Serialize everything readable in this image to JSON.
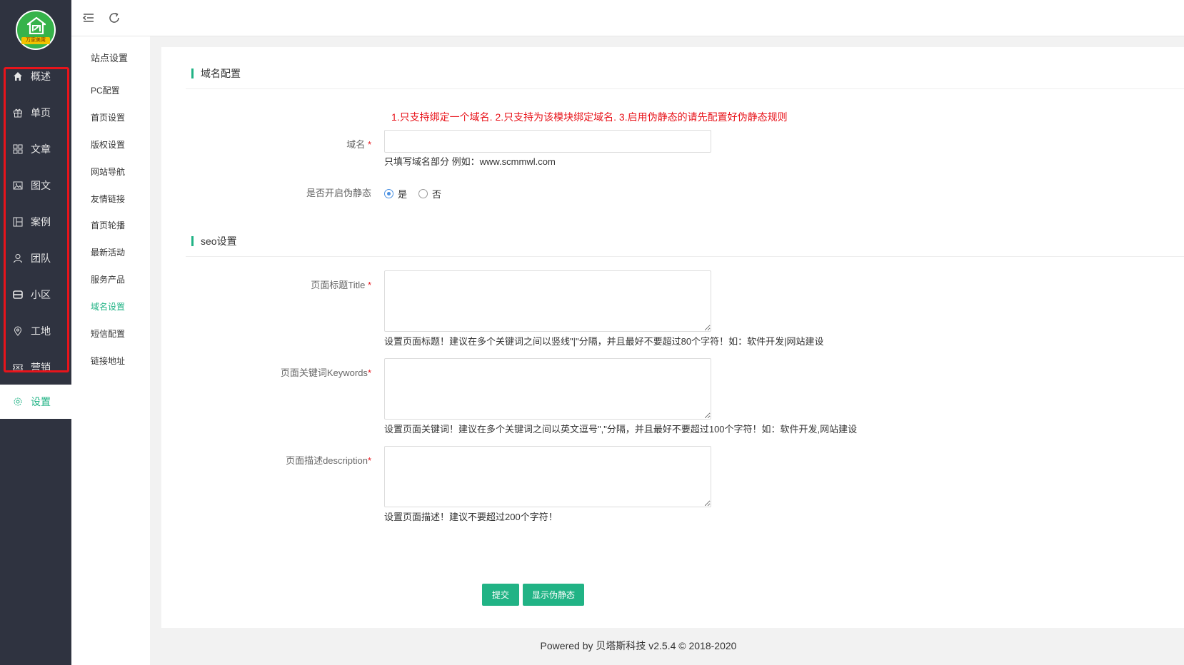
{
  "brand": {
    "logo_text": "万家美寓"
  },
  "sidebar": {
    "items": [
      {
        "label": "概述",
        "icon": "home-icon"
      },
      {
        "label": "单页",
        "icon": "gift-icon"
      },
      {
        "label": "文章",
        "icon": "grid-icon"
      },
      {
        "label": "图文",
        "icon": "image-icon"
      },
      {
        "label": "案例",
        "icon": "layout-icon"
      },
      {
        "label": "团队",
        "icon": "user-icon"
      },
      {
        "label": "小区",
        "icon": "inbox-icon"
      },
      {
        "label": "工地",
        "icon": "location-icon"
      },
      {
        "label": "营销",
        "icon": "ticket-icon"
      },
      {
        "label": "设置",
        "icon": "gear-icon",
        "active": true
      }
    ],
    "highlight_color": "#e8141b"
  },
  "topbar": {
    "menu_icon": "menu-fold-icon",
    "refresh_icon": "refresh-icon"
  },
  "subnav": {
    "title": "站点设置",
    "items": [
      "PC配置",
      "首页设置",
      "版权设置",
      "网站导航",
      "友情链接",
      "首页轮播",
      "最新活动",
      "服务产品",
      "域名设置",
      "短信配置",
      "链接地址"
    ],
    "active_index": 8
  },
  "form": {
    "section_domain": "域名配置",
    "notice": "1.只支持绑定一个域名. 2.只支持为该模块绑定域名. 3.启用伪静态的请先配置好伪静态规则",
    "domain_label": "域名",
    "domain_value": "",
    "domain_hint": "只填写域名部分 例如：www.scmmwl.com",
    "pseudo_label": "是否开启伪静态",
    "pseudo_yes": "是",
    "pseudo_no": "否",
    "pseudo_selected": "是",
    "section_seo": "seo设置",
    "title_label": "页面标题Title",
    "title_value": "",
    "title_hint": "设置页面标题！建议在多个关键词之间以竖线\"|\"分隔，并且最好不要超过80个字符！如：软件开发|网站建设",
    "keywords_label": "页面关键词Keywords",
    "keywords_value": "",
    "keywords_hint": "设置页面关键词！建议在多个关键词之间以英文逗号\",\"分隔，并且最好不要超过100个字符！如：软件开发,网站建设",
    "desc_label": "页面描述description",
    "desc_value": "",
    "desc_hint": "设置页面描述！建议不要超过200个字符！",
    "required_mark": "*",
    "submit_label": "提交",
    "show_pseudo_label": "显示伪静态"
  },
  "footer": "Powered by 贝塔斯科技 v2.5.4 © 2018-2020",
  "colors": {
    "accent": "#21b385",
    "sidebar_bg": "#2f3340",
    "notice": "#e8141b"
  }
}
